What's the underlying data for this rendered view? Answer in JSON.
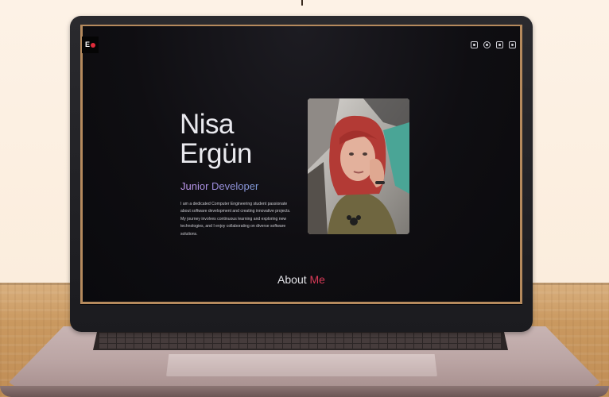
{
  "site": {
    "logo": "E",
    "name_first": "Nisa",
    "name_last": "Ergün",
    "role": "Junior Developer",
    "description": "I am a dedicated Computer Engineering student passionate about software development and creating innovative projects. My journey involves continuous learning and exploring new technologies, and I enjoy collaborating on diverse software solutions.",
    "section_title": "About",
    "section_accent": "Me"
  },
  "social_icons": [
    "linkedin-icon",
    "github-icon",
    "medium-icon",
    "instagram-icon"
  ],
  "colors": {
    "background": "#0c0b0f",
    "frame": "#b58a5d",
    "accent": "#d73a57",
    "role_gradient": [
      "#c69bf2",
      "#7f9ad8"
    ]
  }
}
